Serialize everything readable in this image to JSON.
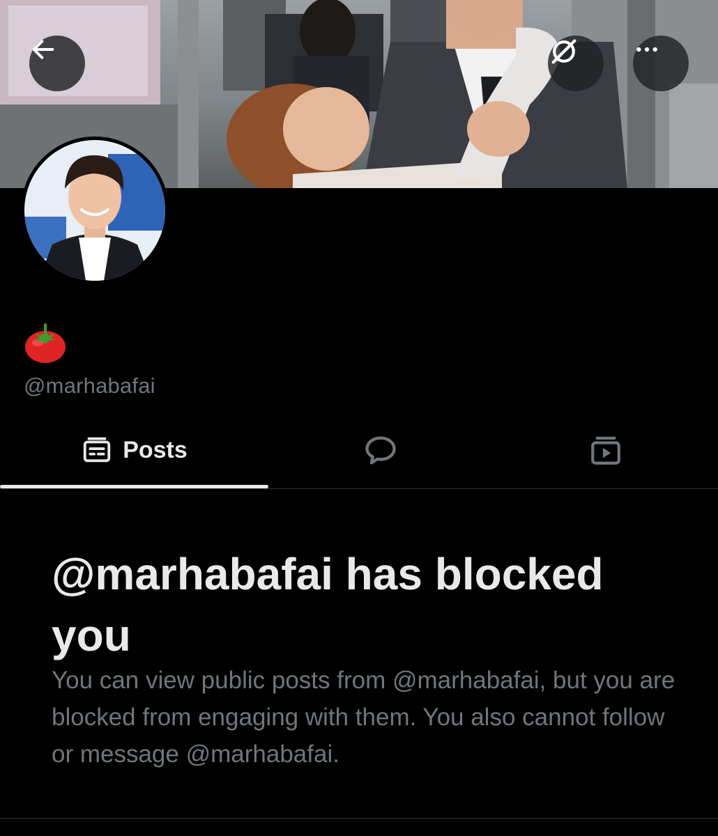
{
  "header": {
    "back_icon": "arrow-left-icon",
    "grok_icon": "grok-icon",
    "more_icon": "more-horizontal-icon"
  },
  "profile": {
    "display_name": "🍅",
    "display_name_icon": "tomato-emoji",
    "handle": "@marhabafai"
  },
  "tabs": [
    {
      "label": "Posts",
      "icon": "posts-icon",
      "selected": true
    },
    {
      "label": "",
      "icon": "replies-icon",
      "selected": false
    },
    {
      "label": "",
      "icon": "media-icon",
      "selected": false
    }
  ],
  "blocked_notice": {
    "title": "@marhabafai has blocked you",
    "body": "You can view public posts from @marhabafai, but you are blocked from engaging with them. You also cannot follow or message @marhabafai."
  },
  "colors": {
    "background": "#000000",
    "primary_text": "#e7e9ea",
    "secondary_text": "#71767b",
    "divider": "#2f3336"
  }
}
